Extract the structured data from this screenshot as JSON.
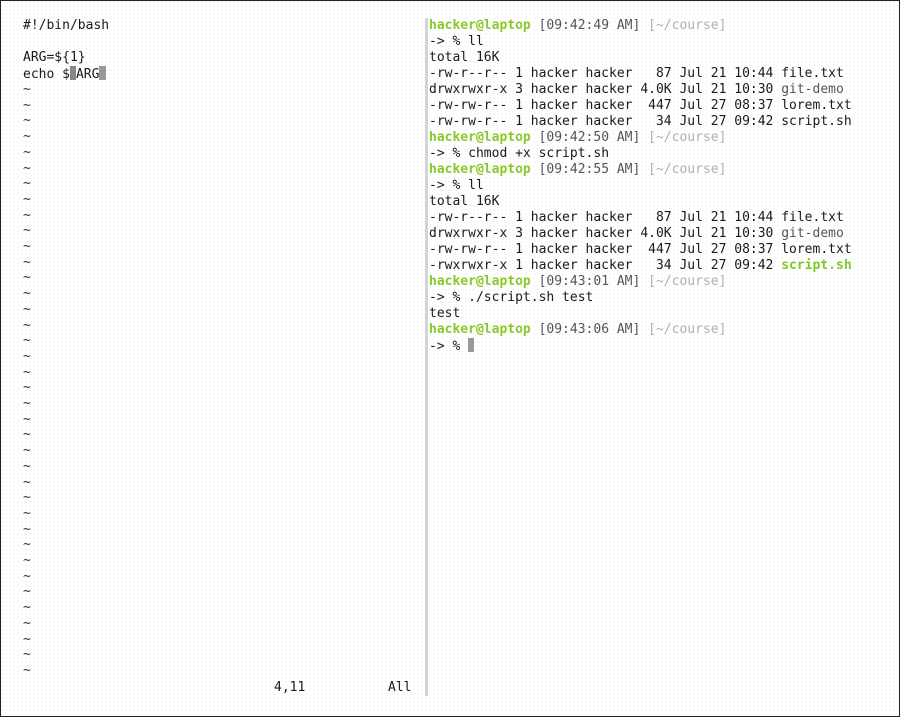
{
  "vim": {
    "lines": [
      "#!/bin/bash",
      "",
      "ARG=${1}"
    ],
    "echo_prefix": "echo $",
    "echo_var": "ARG",
    "tilde": "~",
    "status_pos": "4,11",
    "status_scroll": "All"
  },
  "terminal": {
    "prompt_user": "hacker@laptop",
    "prompt_times": [
      "[09:42:49 AM]",
      "[09:42:50 AM]",
      "[09:42:55 AM]",
      "[09:43:01 AM]",
      "[09:43:06 AM]"
    ],
    "prompt_path": "[~/course]",
    "prompt_arrow": "-> % ",
    "commands": [
      "ll",
      "chmod +x script.sh",
      "ll",
      "./script.sh test"
    ],
    "total": "total 16K",
    "listing1": [
      {
        "prefix": "-rw-r--r-- 1 hacker hacker   87 Jul 21 10:44 ",
        "name": "file.txt"
      },
      {
        "prefix": "drwxrwxr-x 3 hacker hacker 4.0K Jul 21 10:30 ",
        "name": "git-demo"
      },
      {
        "prefix": "-rw-rw-r-- 1 hacker hacker  447 Jul 27 08:37 ",
        "name": "lorem.txt"
      },
      {
        "prefix": "-rw-rw-r-- 1 hacker hacker   34 Jul 27 09:42 ",
        "name": "script.sh"
      }
    ],
    "listing2": [
      {
        "prefix": "-rw-r--r-- 1 hacker hacker   87 Jul 21 10:44 ",
        "name": "file.txt"
      },
      {
        "prefix": "drwxrwxr-x 3 hacker hacker 4.0K Jul 21 10:30 ",
        "name": "git-demo"
      },
      {
        "prefix": "-rw-rw-r-- 1 hacker hacker  447 Jul 27 08:37 ",
        "name": "lorem.txt"
      },
      {
        "prefix": "-rwxrwxr-x 1 hacker hacker   34 Jul 27 09:42 ",
        "name": "script.sh"
      }
    ],
    "output": "test"
  },
  "colors": {
    "prompt_green": "#8ac926",
    "exec_green": "#7ec82a",
    "path_gray": "#b0b0b0"
  }
}
